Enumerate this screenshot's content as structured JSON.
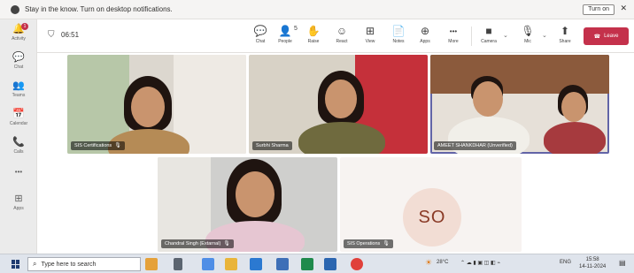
{
  "notification": {
    "message": "Stay in the know. Turn on desktop notifications.",
    "turn_on_label": "Turn on",
    "close_glyph": "✕"
  },
  "rail": {
    "items": [
      {
        "label": "Activity",
        "icon": "bell-icon",
        "glyph": "🔔",
        "badge": "1"
      },
      {
        "label": "Chat",
        "icon": "chat-icon",
        "glyph": "💬"
      },
      {
        "label": "Teams",
        "icon": "teams-icon",
        "glyph": "👥"
      },
      {
        "label": "Calendar",
        "icon": "calendar-icon",
        "glyph": "📅"
      },
      {
        "label": "Calls",
        "icon": "phone-icon",
        "glyph": "📞"
      },
      {
        "label": "",
        "icon": "more-icon",
        "glyph": "•••"
      },
      {
        "label": "Apps",
        "icon": "apps-icon",
        "glyph": "⊞"
      }
    ]
  },
  "meeting": {
    "timer": "06:51",
    "toolbar": {
      "chat": {
        "label": "Chat",
        "glyph": "💬"
      },
      "people": {
        "label": "People",
        "glyph": "👤",
        "count": "5"
      },
      "raise": {
        "label": "Raise",
        "glyph": "✋"
      },
      "react": {
        "label": "React",
        "glyph": "☺"
      },
      "view": {
        "label": "View",
        "glyph": "⊞"
      },
      "notes": {
        "label": "Notes",
        "glyph": "📄"
      },
      "apps": {
        "label": "Apps",
        "glyph": "⊕"
      },
      "more": {
        "label": "More",
        "glyph": "•••"
      },
      "camera": {
        "label": "Camera",
        "glyph": "■"
      },
      "mic": {
        "label": "Mic",
        "glyph": "🎙"
      },
      "share": {
        "label": "Share",
        "glyph": "⬆"
      },
      "leave": {
        "label": "Leave",
        "glyph": "☎"
      }
    }
  },
  "participants": [
    {
      "name": "SIS Certifications"
    },
    {
      "name": "Surbhi Sharma"
    },
    {
      "name": "AMEET SHANKDHAR (Unverified)"
    },
    {
      "name": "Chandral Singh (Extarnal)"
    },
    {
      "name": "SIS Operations",
      "initials": "SO"
    }
  ],
  "taskbar": {
    "search_placeholder": "Type here to search",
    "weather": "28°C",
    "lang": "ENG",
    "time": "15:58",
    "date": "14-11-2024"
  },
  "colors": {
    "accent": "#6264a7",
    "leave": "#c4314b"
  }
}
